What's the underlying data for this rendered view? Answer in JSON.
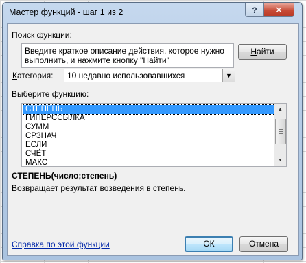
{
  "dialog": {
    "title": "Мастер функций - шаг 1 из 2",
    "help_label": "?",
    "close_label": "✕"
  },
  "search": {
    "label": "Поиск функции:",
    "description": "Введите краткое описание действия, которое нужно\nвыполнить, и нажмите кнопку \"Найти\"",
    "find_button": {
      "prefix": "",
      "accel": "Н",
      "rest": "айти"
    }
  },
  "category": {
    "label_accel": "К",
    "label_rest": "атегория:",
    "selected": "10 недавно использовавшихся",
    "arrow": "▼"
  },
  "function_list": {
    "label_prefix": "Выберите ",
    "label_accel": "ф",
    "label_rest": "ункцию:",
    "items": [
      "СТЕПЕНЬ",
      "ГИПЕРССЫЛКА",
      "СУММ",
      "СРЗНАЧ",
      "ЕСЛИ",
      "СЧЁТ",
      "МАКС"
    ],
    "selected_index": 0,
    "scroll_up": "▲",
    "scroll_down": "▼"
  },
  "selected_function": {
    "signature": "СТЕПЕНЬ(число;степень)",
    "description": "Возвращает результат возведения в степень."
  },
  "footer": {
    "help_link": "Справка по этой функции",
    "ok_label": "ОК",
    "cancel_label": "Отмена"
  }
}
